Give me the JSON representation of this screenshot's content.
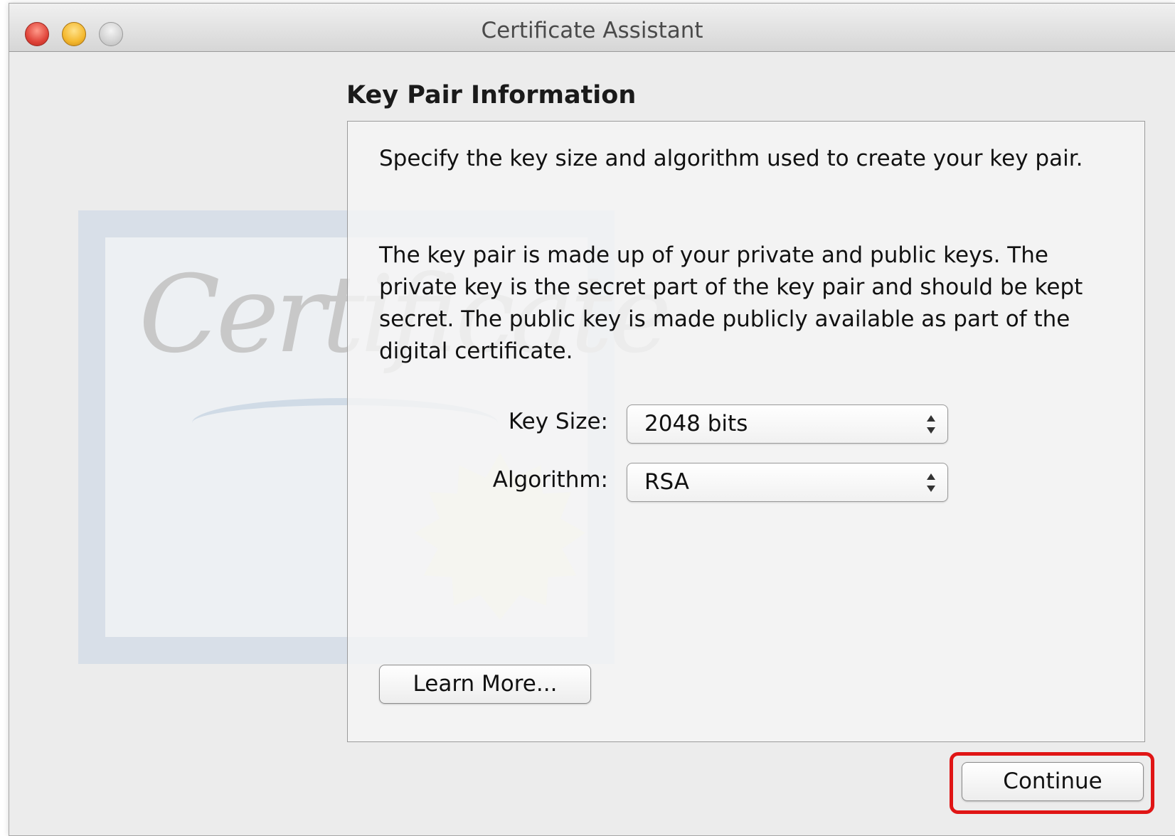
{
  "window": {
    "title": "Certificate Assistant"
  },
  "watermark": {
    "script_text": "Certificate"
  },
  "page": {
    "heading": "Key Pair Information",
    "paragraph1": "Specify the key size and algorithm used to create your key pair.",
    "paragraph2": "The key pair is made up of your private and public keys. The private key is the secret part of the key pair and should be kept secret. The public key is made publicly available as part of the digital certificate."
  },
  "form": {
    "key_size": {
      "label": "Key Size:",
      "value": "2048 bits"
    },
    "algorithm": {
      "label": "Algorithm:",
      "value": "RSA"
    }
  },
  "buttons": {
    "learn_more": "Learn More...",
    "continue": "Continue"
  },
  "colors": {
    "highlight": "#e01515",
    "close": "#e0443a",
    "minimize": "#f4b82e",
    "zoom": "#d2d2d2"
  }
}
